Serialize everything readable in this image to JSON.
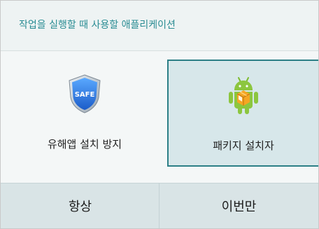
{
  "dialog": {
    "title": "작업을 실행할 때 사용할 애플리케이션",
    "apps": [
      {
        "label": "유해앱 설치 방지",
        "icon": "safe-shield-icon",
        "icon_text": "SAFE",
        "selected": false
      },
      {
        "label": "패키지 설치자",
        "icon": "android-package-installer-icon",
        "selected": true
      }
    ],
    "buttons": {
      "always": "항상",
      "just_once": "이번만"
    },
    "colors": {
      "accent": "#2c7f86",
      "title_text": "#2a8c93",
      "selected_bg": "#d7e7ea"
    }
  }
}
